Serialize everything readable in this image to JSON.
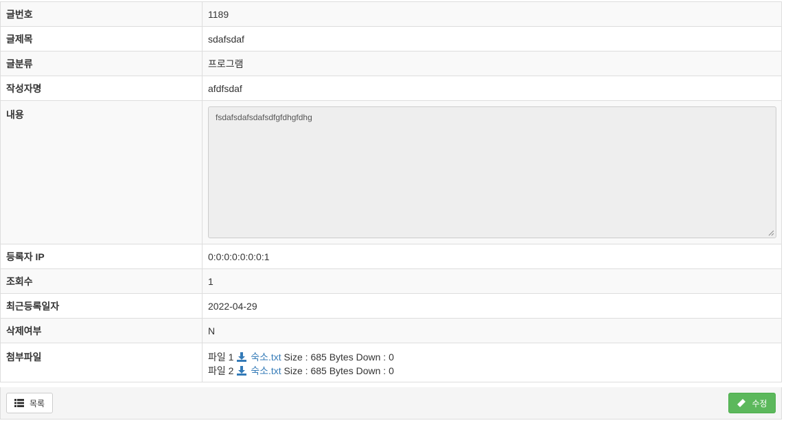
{
  "rows": [
    {
      "label": "글번호",
      "value": "1189"
    },
    {
      "label": "글제목",
      "value": "sdafsdaf"
    },
    {
      "label": "글분류",
      "value": "프로그램"
    },
    {
      "label": "작성자명",
      "value": "afdfsdaf"
    }
  ],
  "content": {
    "label": "내용",
    "value": "fsdafsdafsdafsdfgfdhgfdhg"
  },
  "rows2": [
    {
      "label": "등록자 IP",
      "value": "0:0:0:0:0:0:0:1"
    },
    {
      "label": "조회수",
      "value": "1"
    },
    {
      "label": "최근등록일자",
      "value": "2022-04-29"
    },
    {
      "label": "삭제여부",
      "value": "N"
    }
  ],
  "files": {
    "label": "첨부파일",
    "items": [
      {
        "prefix": "파일 1",
        "name": "숙소.txt",
        "info": "Size : 685 Bytes Down : 0"
      },
      {
        "prefix": "파일 2",
        "name": "숙소.txt",
        "info": "Size : 685 Bytes Down : 0"
      }
    ]
  },
  "buttons": {
    "list_label": "목록",
    "edit_label": "수정"
  },
  "icons": {
    "download": "download-icon",
    "list": "list-icon",
    "edit": "pencil-icon"
  },
  "colors": {
    "link": "#337ab7",
    "edit_button": "#5cb85c",
    "stripe": "#f9f9f9"
  }
}
